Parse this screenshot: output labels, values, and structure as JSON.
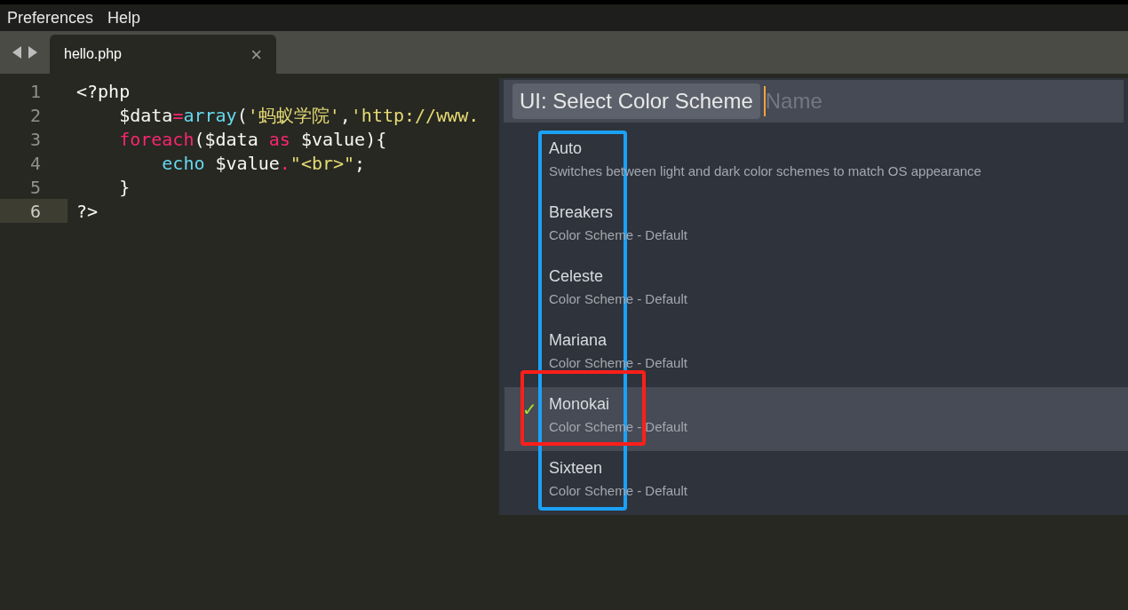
{
  "menu": [
    "Preferences",
    "Help"
  ],
  "tabs": [
    {
      "label": "hello.php",
      "selected": true
    }
  ],
  "close_glyph": "×",
  "check_glyph": "✓",
  "code": [
    {
      "number": "1",
      "current": false,
      "tokens": [
        {
          "kind": "plain",
          "text": "<?php"
        }
      ]
    },
    {
      "number": "2",
      "current": false,
      "tokens": [
        {
          "kind": "plain",
          "text": "    $data"
        },
        {
          "kind": "operator",
          "text": "="
        },
        {
          "kind": "function",
          "text": "array"
        },
        {
          "kind": "plain",
          "text": "("
        },
        {
          "kind": "string",
          "text": "'蚂蚁学院'"
        },
        {
          "kind": "plain",
          "text": ","
        },
        {
          "kind": "string",
          "text": "'http://www."
        }
      ]
    },
    {
      "number": "3",
      "current": false,
      "tokens": [
        {
          "kind": "keyword",
          "text": "    foreach"
        },
        {
          "kind": "plain",
          "text": "($data "
        },
        {
          "kind": "keyword",
          "text": "as"
        },
        {
          "kind": "plain",
          "text": " $value){"
        }
      ]
    },
    {
      "number": "4",
      "current": false,
      "tokens": [
        {
          "kind": "function",
          "text": "        echo"
        },
        {
          "kind": "plain",
          "text": " $value"
        },
        {
          "kind": "operator",
          "text": "."
        },
        {
          "kind": "string",
          "text": "\"<br>\""
        },
        {
          "kind": "plain",
          "text": ";"
        }
      ]
    },
    {
      "number": "5",
      "current": false,
      "tokens": [
        {
          "kind": "plain",
          "text": "    }"
        }
      ]
    },
    {
      "number": "6",
      "current": true,
      "tokens": [
        {
          "kind": "plain",
          "text": "?>"
        }
      ]
    }
  ],
  "palette": {
    "prefix": "UI: Select Color Scheme",
    "placeholder": "Name",
    "items": [
      {
        "name": "Auto",
        "detail": "Switches between light and dark color schemes to match OS appearance",
        "selected": false
      },
      {
        "name": "Breakers",
        "detail": "Color Scheme - Default",
        "selected": false
      },
      {
        "name": "Celeste",
        "detail": "Color Scheme - Default",
        "selected": false
      },
      {
        "name": "Mariana",
        "detail": "Color Scheme - Default",
        "selected": false
      },
      {
        "name": "Monokai",
        "detail": "Color Scheme - Default",
        "selected": true
      },
      {
        "name": "Sixteen",
        "detail": "Color Scheme - Default",
        "selected": false
      }
    ]
  }
}
